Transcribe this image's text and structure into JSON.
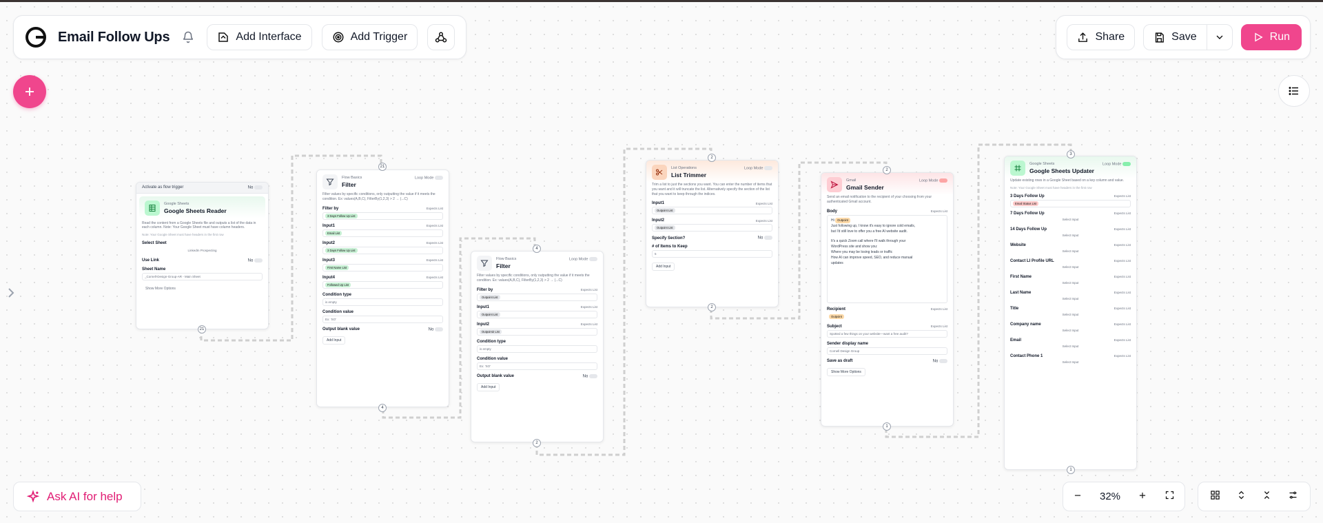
{
  "header": {
    "title": "Email Follow Ups",
    "add_interface": "Add Interface",
    "add_trigger": "Add Trigger",
    "share": "Share",
    "save": "Save",
    "run": "Run"
  },
  "footer": {
    "ask_ai": "Ask AI for help",
    "zoom": "32%"
  },
  "colors": {
    "accent": "#f0468d",
    "ask_ai": "#e11d74"
  },
  "nodes": {
    "sheets_reader": {
      "trigger_label": "Activate as flow trigger",
      "trigger_value": "No",
      "category": "Google Sheets",
      "title": "Google Sheets Reader",
      "desc": "Read the content from a Google Sheets file and outputs a list of the data in each column. Note: Your Google Sheet must have column headers.",
      "note": "Note: Your Google Sheet must have headers in the first row",
      "select_sheet_label": "Select Sheet",
      "select_sheet_value": "LinkedIn Prospecting",
      "use_link_label": "Use Link",
      "use_link_value": "No",
      "sheet_name_label": "Sheet Name",
      "sheet_name_value": "_Cornell-Design-Group-AR - Main Sheet",
      "show_more": "Show More Options",
      "badge": "21"
    },
    "filter1": {
      "category": "Flow Basics",
      "title": "Filter",
      "loop_mode": "Loop Mode",
      "desc": "Filter values by specific conditions, only outputting the value if it meets the condition. Ex: values(A,B,C), FilterBy(1,2,3) > 2 → (...C)",
      "filter_by": "Filter by",
      "filter_by_chip": "3 Days Follow Up List",
      "input1": "Input1",
      "input1_chip": "Email List",
      "input2": "Input2",
      "input2_chip": "3 Days Follow Up List",
      "input3": "Input3",
      "input3_chip": "First Name List",
      "input4": "Input4",
      "input4_chip": "Followed Up List",
      "expects": "Expects List",
      "condition_type": "Condition type",
      "condition_type_value": "is empty",
      "condition_value": "Condition value",
      "condition_value_ph": "Ex: 'SO'",
      "output_blank": "Output blank value",
      "output_blank_value": "No",
      "add_input": "Add Input",
      "badge_top": "21",
      "badge_bottom": "4"
    },
    "filter2": {
      "category": "Flow Basics",
      "title": "Filter",
      "loop_mode": "Loop Mode",
      "desc": "Filter values by specific conditions, only outputting the value if it meets the condition. Ex: values(A,B,C), FilterBy(1,2,3) > 2 → (...C)",
      "filter_by": "Filter by",
      "filter_by_chip": "Outpoint List",
      "input1": "Input1",
      "input1_chip": "Outpoint List",
      "input2": "Input2",
      "input2_chip": "Outpoint2 List",
      "expects": "Expects List",
      "condition_type": "Condition type",
      "condition_type_value": "is empty",
      "condition_value": "Condition value",
      "condition_value_ph": "Ex: 'SO'",
      "output_blank": "Output blank value",
      "output_blank_value": "No",
      "add_input": "Add Input",
      "badge_top": "4",
      "badge_bottom": "2"
    },
    "list_trimmer": {
      "category": "List Operations",
      "title": "List Trimmer",
      "loop_mode": "Loop Mode",
      "desc": "Trim a list to just the sections you want. You can enter the number of items that you want and it will truncate the list. Alternatively specify the section of the list that you want to keep through the indices.",
      "input1": "Input1",
      "input1_chip": "Outpoint List",
      "input2": "Input2",
      "input2_chip": "Outpoint List",
      "expects": "Expects List",
      "specify_section": "Specify Section?",
      "specify_section_value": "No",
      "items_keep": "# of Items to Keep",
      "items_keep_value": "5",
      "add_input": "Add Input",
      "badge_top": "2",
      "badge_bottom": "2"
    },
    "gmail": {
      "category": "Gmail",
      "title": "Gmail Sender",
      "loop_mode": "Loop Mode",
      "desc": "Send an email notification to the recipient of your choosing from your authenticated Gmail account.",
      "body_label": "Body",
      "body_hi": "Hi",
      "body_chip": "Outpoint",
      "body_lines": [
        "Just following up, I know it's easy to ignore cold emails,",
        "but I'd still love to offer you a free AI website audit.",
        "",
        "It's a quick Zoom call where I'll walk through your",
        "WordPress site and show you:",
        "Where you may be losing leads or traffic",
        "How AI can improve speed, SEO, and reduce manual",
        "updates"
      ],
      "expects": "Expects List",
      "recipient_label": "Recipient",
      "recipient_chip": "Outpoint",
      "subject_label": "Subject",
      "subject_value": "Spotted a few things on your website—want a free audit?",
      "sender_label": "Sender display name",
      "sender_value": "Cornell Design Group",
      "draft_label": "Save as draft",
      "draft_value": "No",
      "show_more": "Show More Options",
      "badge_top": "2",
      "badge_bottom": "1"
    },
    "sheets_updater": {
      "category": "Google Sheets",
      "title": "Google Sheets Updater",
      "loop_mode": "Loop Mode",
      "desc": "Update existing rows in a Google Sheet based on a key column and value.",
      "note": "Note: Your Google Sheet must have headers in the first row",
      "first_label": "3 Days Follow Up",
      "first_chip": "Email Status List",
      "expects": "Expects List",
      "select_input": "Select Input",
      "columns": [
        "7 Days Follow Up",
        "14 Days Follow Up",
        "Website",
        "Contact LI Profile URL",
        "First Name",
        "Last Name",
        "Title",
        "Company name",
        "Email",
        "Contact Phone 1"
      ],
      "badge_top": "3",
      "badge_bottom": "1"
    }
  }
}
